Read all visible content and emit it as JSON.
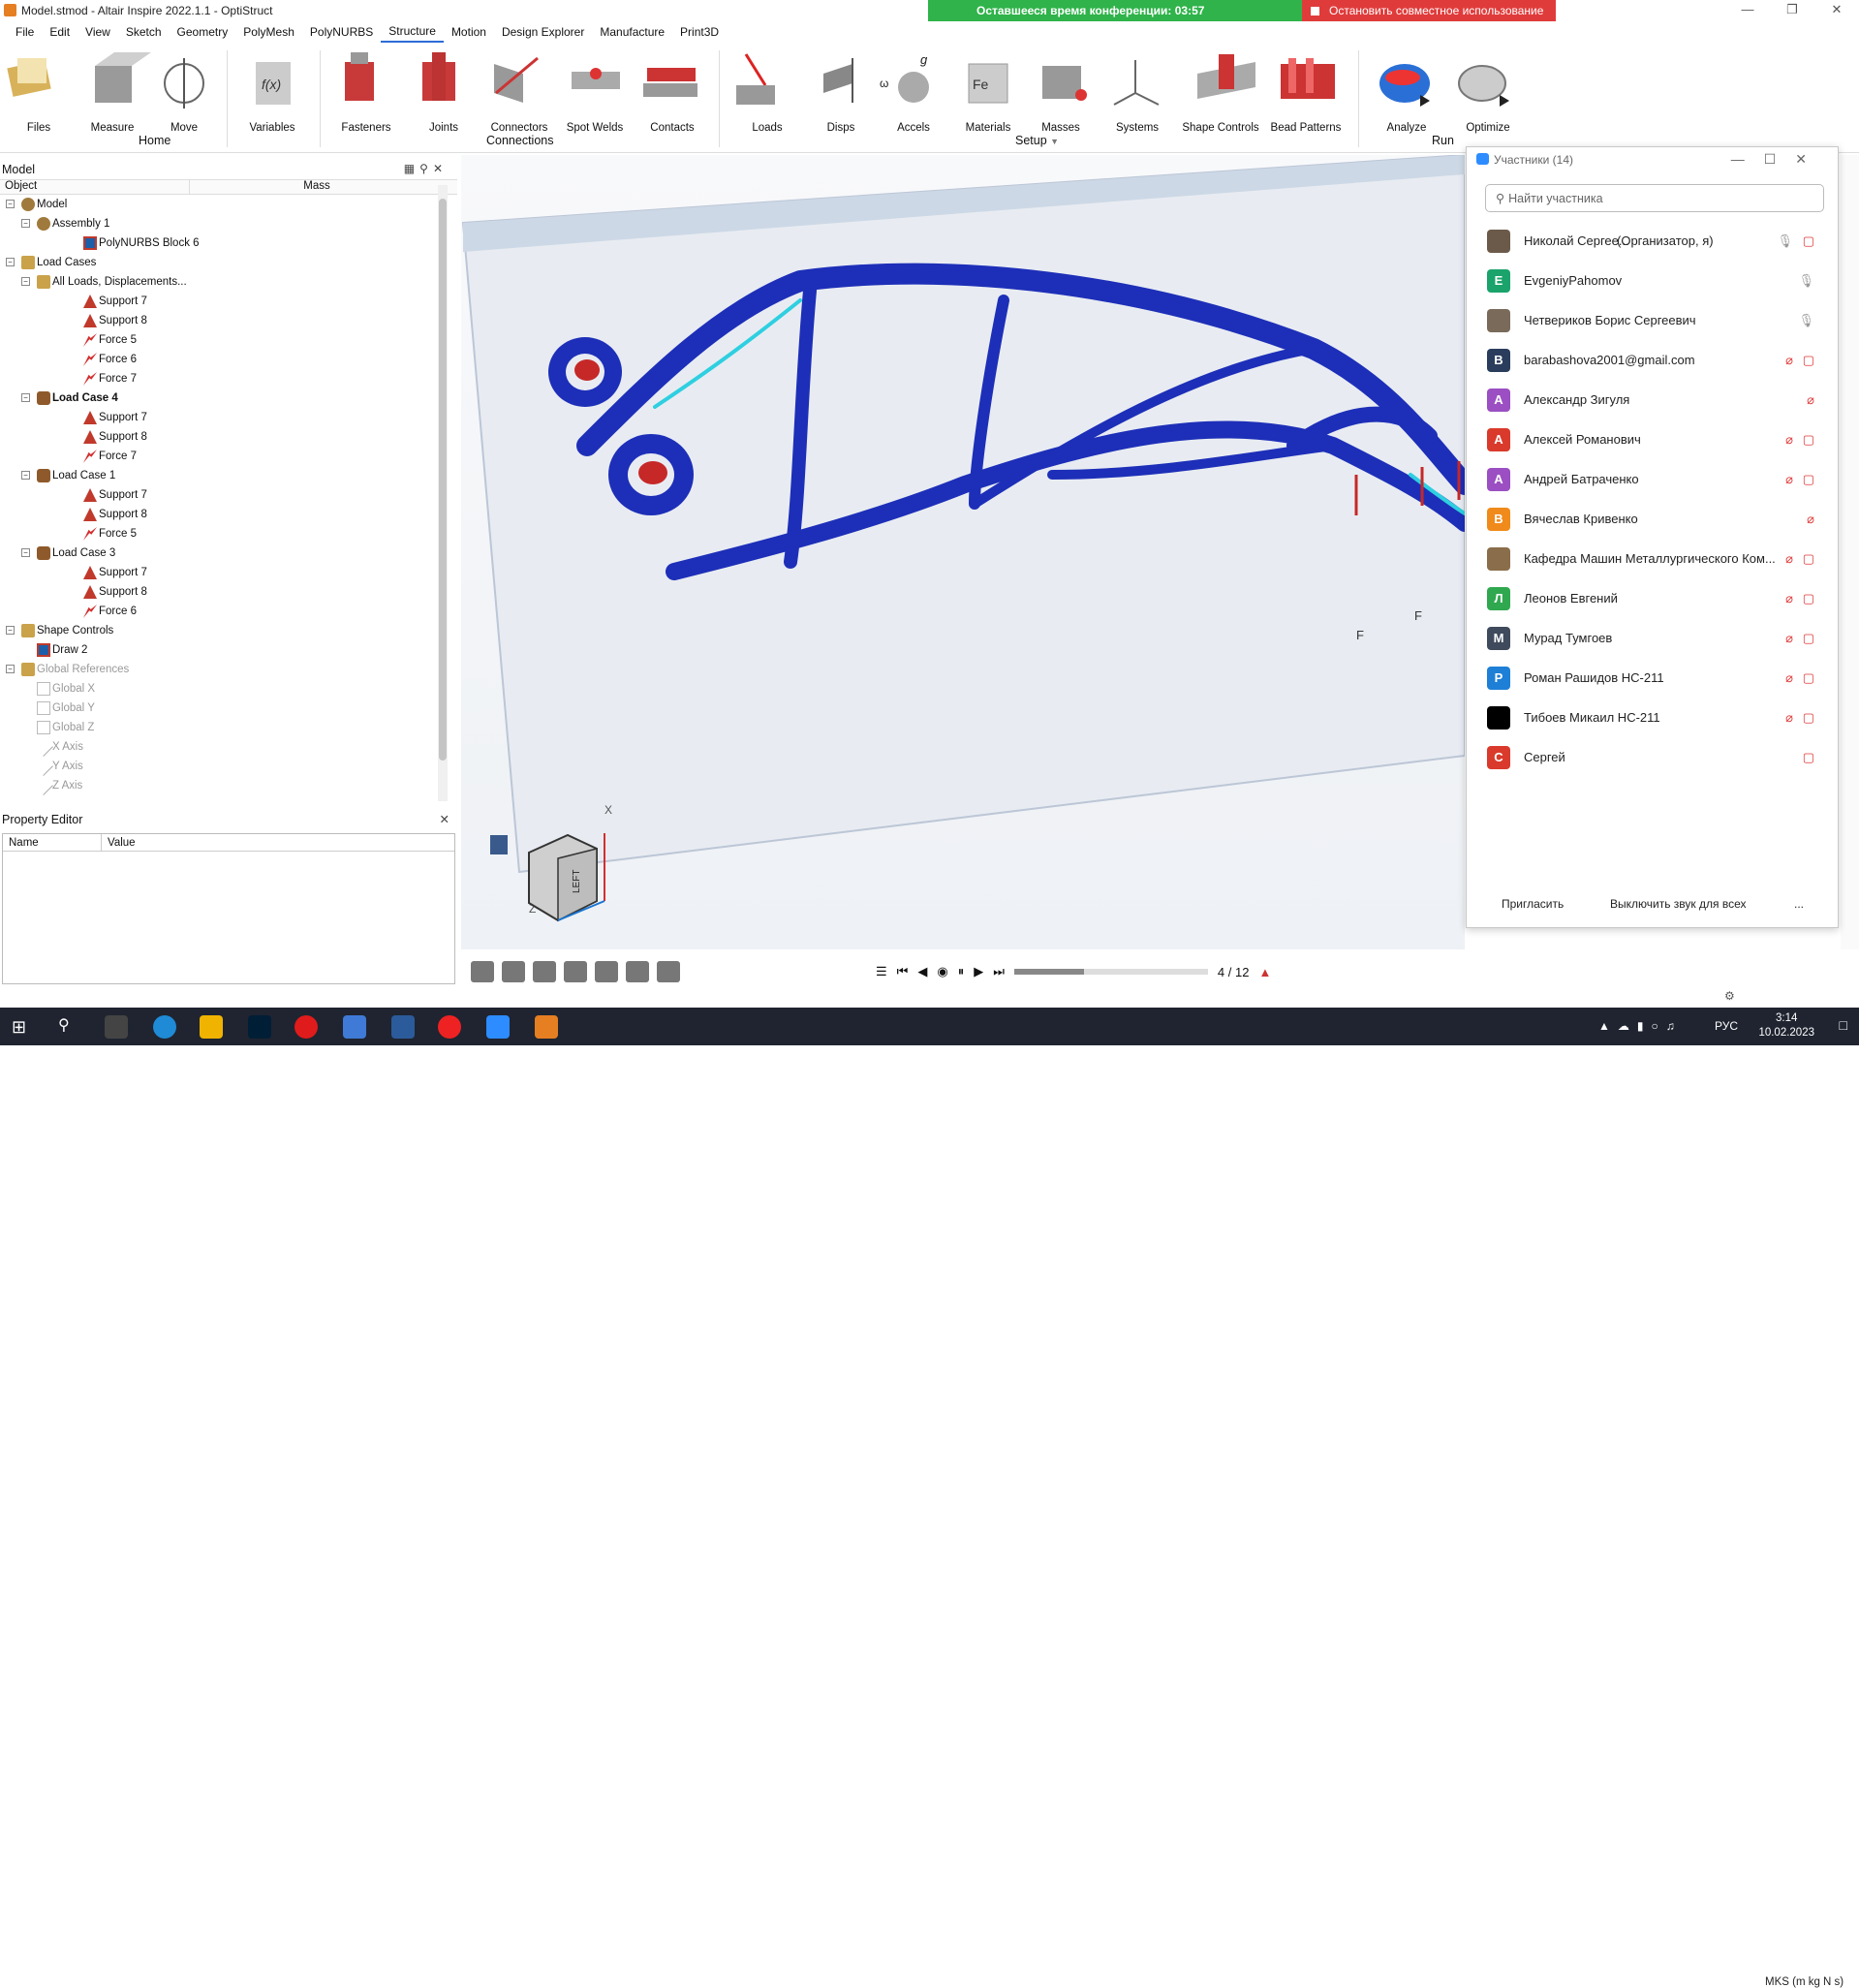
{
  "app": {
    "title": "Model.stmod - Altair Inspire 2022.1.1 - OptiStruct"
  },
  "conference": {
    "remaining": "Оставшееся время конференции: 03:57",
    "stop_share": "Остановить совместное использование",
    "banner_color": "#2fb34a",
    "stop_color": "#e03b3b"
  },
  "menu": [
    "File",
    "Edit",
    "View",
    "Sketch",
    "Geometry",
    "PolyMesh",
    "PolyNURBS",
    "Structure",
    "Motion",
    "Design Explorer",
    "Manufacture",
    "Print3D"
  ],
  "menu_active": "Structure",
  "ribbon": {
    "buttons": {
      "files": "Files",
      "measure": "Measure",
      "move": "Move",
      "variables": "Variables",
      "fasteners": "Fasteners",
      "joints": "Joints",
      "connectors": "Connectors",
      "spot_welds": "Spot Welds",
      "contacts": "Contacts",
      "loads": "Loads",
      "disps": "Disps",
      "accels": "Accels",
      "materials": "Materials",
      "masses": "Masses",
      "systems": "Systems",
      "shape_controls": "Shape Controls",
      "bead_patterns": "Bead Patterns",
      "analyze": "Analyze",
      "optimize": "Optimize"
    },
    "groups": {
      "home": "Home",
      "connections": "Connections",
      "setup": "Setup",
      "run": "Run"
    }
  },
  "model_panel": {
    "title": "Model",
    "col_object": "Object",
    "col_mass": "Mass",
    "tree": [
      {
        "label": "Model",
        "icon": "asm"
      },
      {
        "label": "Assembly 1",
        "icon": "asm"
      },
      {
        "label": "PolyNURBS Block 6",
        "icon": "block"
      },
      {
        "label": "Load Cases",
        "icon": "folder"
      },
      {
        "label": "All Loads, Displacements...",
        "icon": "folder"
      },
      {
        "label": "Support 7",
        "icon": "support"
      },
      {
        "label": "Support 8",
        "icon": "support"
      },
      {
        "label": "Force 5",
        "icon": "force"
      },
      {
        "label": "Force 6",
        "icon": "force"
      },
      {
        "label": "Force 7",
        "icon": "force"
      },
      {
        "label": "Load Case 4",
        "icon": "lcase"
      },
      {
        "label": "Support 7",
        "icon": "support"
      },
      {
        "label": "Support 8",
        "icon": "support"
      },
      {
        "label": "Force 7",
        "icon": "force"
      },
      {
        "label": "Load Case 1",
        "icon": "lcase"
      },
      {
        "label": "Support 7",
        "icon": "support"
      },
      {
        "label": "Support 8",
        "icon": "support"
      },
      {
        "label": "Force 5",
        "icon": "force"
      },
      {
        "label": "Load Case 3",
        "icon": "lcase"
      },
      {
        "label": "Support 7",
        "icon": "support"
      },
      {
        "label": "Support 8",
        "icon": "support"
      },
      {
        "label": "Force 6",
        "icon": "force"
      },
      {
        "label": "Shape Controls",
        "icon": "folder"
      },
      {
        "label": "Draw 2",
        "icon": "block"
      },
      {
        "label": "Global References",
        "icon": "folder"
      },
      {
        "label": "Global X",
        "icon": "checkbox"
      },
      {
        "label": "Global Y",
        "icon": "checkbox"
      },
      {
        "label": "Global Z",
        "icon": "checkbox"
      },
      {
        "label": "X Axis",
        "icon": "axis"
      },
      {
        "label": "Y Axis",
        "icon": "axis"
      },
      {
        "label": "Z Axis",
        "icon": "axis"
      }
    ]
  },
  "property_editor": {
    "title": "Property Editor",
    "col_name": "Name",
    "col_value": "Value"
  },
  "viewport": {
    "axis_x": "X",
    "axis_z": "Z",
    "force_label": "F",
    "cube_face": "LEFT",
    "page": "4 / 12",
    "mesh_color": "#1d2fb8",
    "hotspot_color": "#2ecfe0"
  },
  "participants": {
    "title": "Участники (14)",
    "search_placeholder": "Найти участника",
    "list": [
      {
        "name": "Николай Сергее...",
        "tag": "(Организатор, я)",
        "initial": "",
        "color": "#6b5a4a",
        "mic": "on",
        "cam": "off"
      },
      {
        "name": "EvgeniyPahomov",
        "tag": "",
        "initial": "E",
        "color": "#1aa36b",
        "mic": "on",
        "cam": "none"
      },
      {
        "name": "Четвериков Борис Сергеевич",
        "tag": "",
        "initial": "",
        "color": "#7a6a5a",
        "mic": "on",
        "cam": "none"
      },
      {
        "name": "barabashova2001@gmail.com",
        "tag": "",
        "initial": "B",
        "color": "#2b3d5c",
        "mic": "muted",
        "cam": "off"
      },
      {
        "name": "Александр Зигуля",
        "tag": "",
        "initial": "A",
        "color": "#9b4fc2",
        "mic": "muted_only",
        "cam": "none"
      },
      {
        "name": "Алексей Романович",
        "tag": "",
        "initial": "A",
        "color": "#d93a2b",
        "mic": "muted",
        "cam": "off"
      },
      {
        "name": "Андрей Батраченко",
        "tag": "",
        "initial": "A",
        "color": "#9b4fc2",
        "mic": "muted",
        "cam": "off"
      },
      {
        "name": "Вячеслав Кривенко",
        "tag": "",
        "initial": "B",
        "color": "#f08a1a",
        "mic": "muted_only",
        "cam": "none"
      },
      {
        "name": "Кафедра Машин Металлургического Ком...",
        "tag": "",
        "initial": "",
        "color": "#8a6d4a",
        "mic": "muted",
        "cam": "off"
      },
      {
        "name": "Леонов Евгений",
        "tag": "",
        "initial": "Л",
        "color": "#2fa84f",
        "mic": "muted",
        "cam": "off"
      },
      {
        "name": "Мурад Тумгоев",
        "tag": "",
        "initial": "M",
        "color": "#3f4a5c",
        "mic": "muted",
        "cam": "off"
      },
      {
        "name": "Роман Рашидов НС-211",
        "tag": "",
        "initial": "P",
        "color": "#1e7fd6",
        "mic": "muted",
        "cam": "off"
      },
      {
        "name": "Тибоев Микаил НС-211",
        "tag": "",
        "initial": "",
        "color": "#000000",
        "mic": "muted",
        "cam": "off"
      },
      {
        "name": "Сергей",
        "tag": "",
        "initial": "C",
        "color": "#d93a2b",
        "mic": "none",
        "cam": "off"
      }
    ],
    "invite": "Пригласить",
    "mute_all": "Выключить звук для всех",
    "more": "..."
  },
  "status": {
    "units": "MKS (m kg N s)"
  },
  "taskbar": {
    "lang": "РУС",
    "time": "3:14",
    "date": "10.02.2023"
  }
}
